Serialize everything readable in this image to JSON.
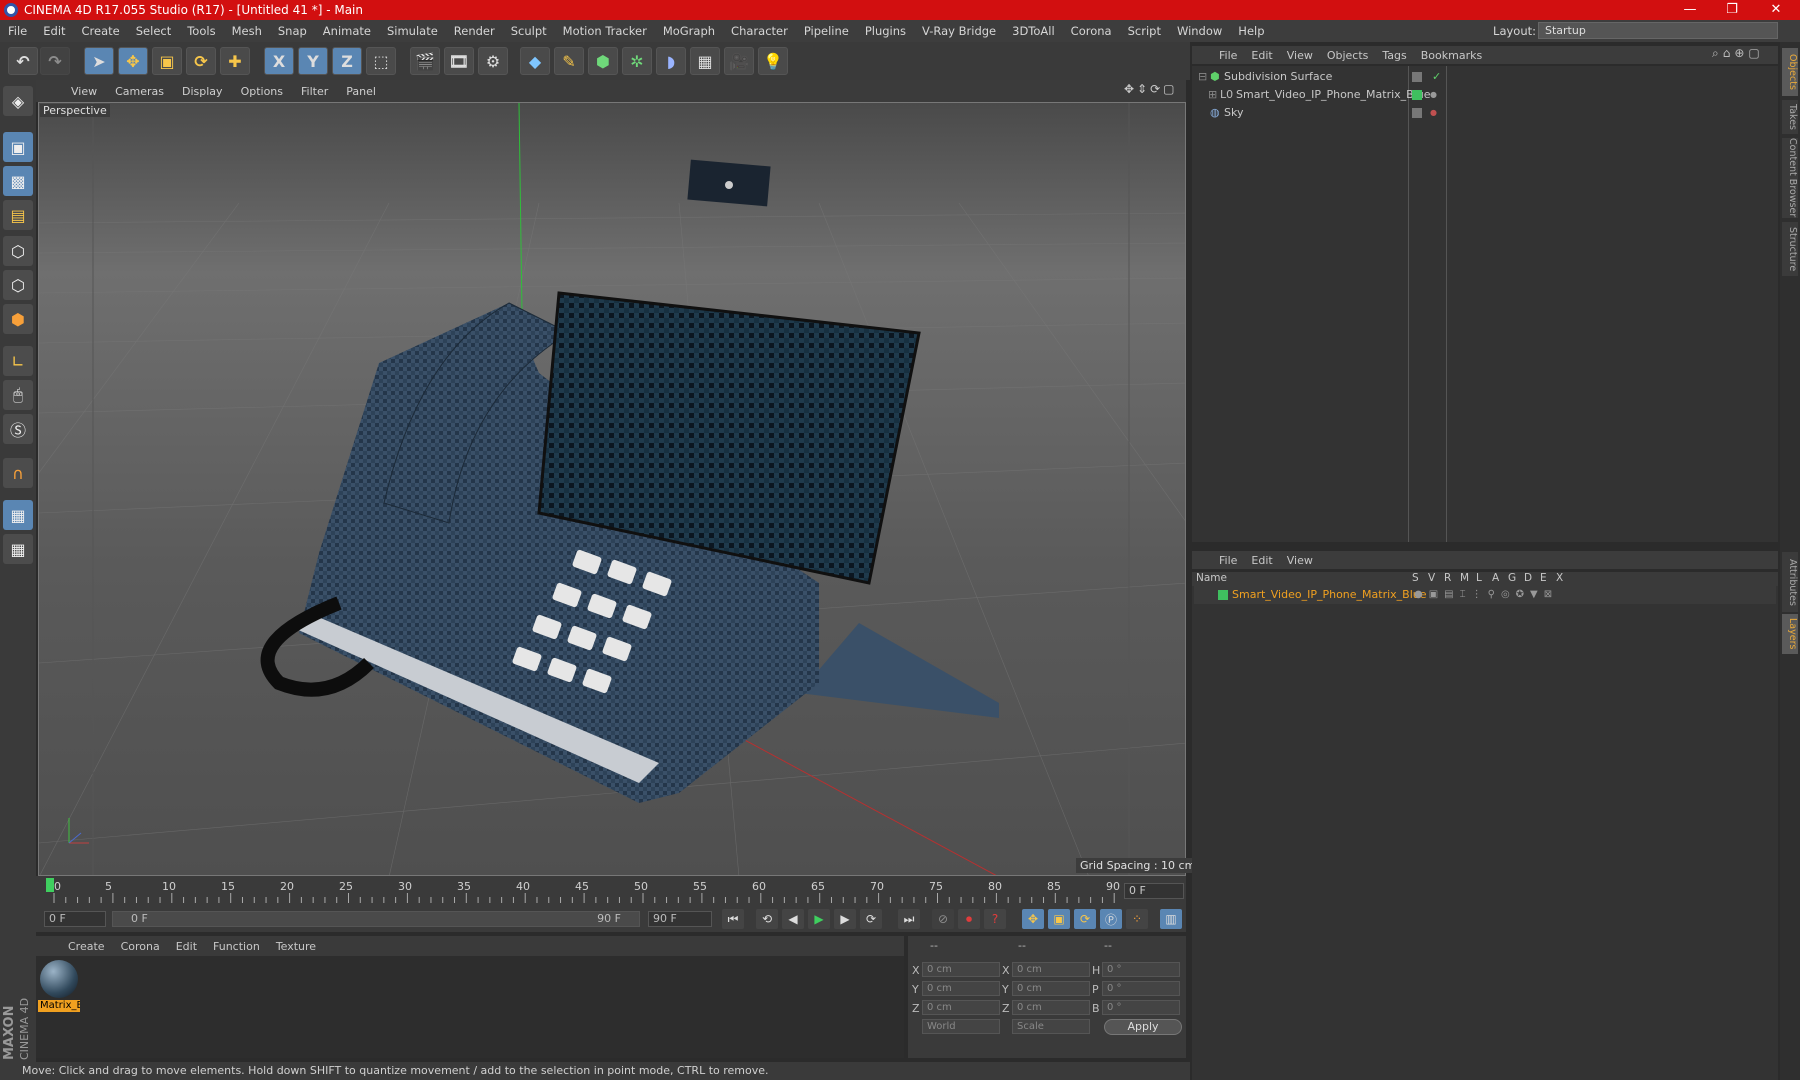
{
  "window": {
    "title": "CINEMA 4D R17.055 Studio (R17) - [Untitled 41 *] - Main",
    "minimize": "—",
    "restore": "❐",
    "close": "✕"
  },
  "menu": [
    "File",
    "Edit",
    "Create",
    "Select",
    "Tools",
    "Mesh",
    "Snap",
    "Animate",
    "Simulate",
    "Render",
    "Sculpt",
    "Motion Tracker",
    "MoGraph",
    "Character",
    "Pipeline",
    "Plugins",
    "V-Ray Bridge",
    "3DToAll",
    "Corona",
    "Script",
    "Window",
    "Help"
  ],
  "layout": {
    "label": "Layout:",
    "value": "Startup"
  },
  "toolbar": {
    "x": "X",
    "y": "Y",
    "z": "Z"
  },
  "viewport": {
    "menu": [
      "View",
      "Cameras",
      "Display",
      "Options",
      "Filter",
      "Panel"
    ],
    "label": "Perspective",
    "grid_spacing": "Grid Spacing : 10 cm"
  },
  "timeline": {
    "ticks": [
      "0",
      "5",
      "10",
      "15",
      "20",
      "25",
      "30",
      "35",
      "40",
      "45",
      "50",
      "55",
      "60",
      "65",
      "70",
      "75",
      "80",
      "85",
      "90"
    ],
    "frame_end_display": "0 F",
    "start_field": "0 F",
    "range_start": "0 F",
    "range_end": "90 F",
    "end_field": "90 F"
  },
  "materials": {
    "menu": [
      "Create",
      "Corona",
      "Edit",
      "Function",
      "Texture"
    ],
    "items": [
      {
        "name": "Matrix_B"
      }
    ]
  },
  "coords": {
    "headers": [
      "--",
      "--",
      "--"
    ],
    "rows": [
      {
        "a": "X",
        "av": "0 cm",
        "b": "X",
        "bv": "0 cm",
        "c": "H",
        "cv": "0 °"
      },
      {
        "a": "Y",
        "av": "0 cm",
        "b": "Y",
        "bv": "0 cm",
        "c": "P",
        "cv": "0 °"
      },
      {
        "a": "Z",
        "av": "0 cm",
        "b": "Z",
        "bv": "0 cm",
        "c": "B",
        "cv": "0 °"
      }
    ],
    "mode1": "World",
    "mode2": "Scale",
    "apply": "Apply"
  },
  "status": "Move: Click and drag to move elements. Hold down SHIFT to quantize movement / add to the selection in point mode, CTRL to remove.",
  "objects": {
    "menu": [
      "File",
      "Edit",
      "View",
      "Objects",
      "Tags",
      "Bookmarks"
    ],
    "items": [
      {
        "name": "Subdivision Surface"
      },
      {
        "name": "Smart_Video_IP_Phone_Matrix_Blue"
      },
      {
        "name": "Sky"
      }
    ]
  },
  "layers": {
    "menu": [
      "File",
      "Edit",
      "View"
    ],
    "columns": [
      "Name",
      "S",
      "V",
      "R",
      "M",
      "L",
      "A",
      "G",
      "D",
      "E",
      "X"
    ],
    "items": [
      {
        "name": "Smart_Video_IP_Phone_Matrix_Blue"
      }
    ]
  },
  "right_tabs": [
    "Objects",
    "Takes",
    "Content Browser",
    "Structure",
    "Attributes",
    "Layers"
  ],
  "brand": {
    "maxon": "MAXON",
    "cinema": "CINEMA 4D"
  }
}
